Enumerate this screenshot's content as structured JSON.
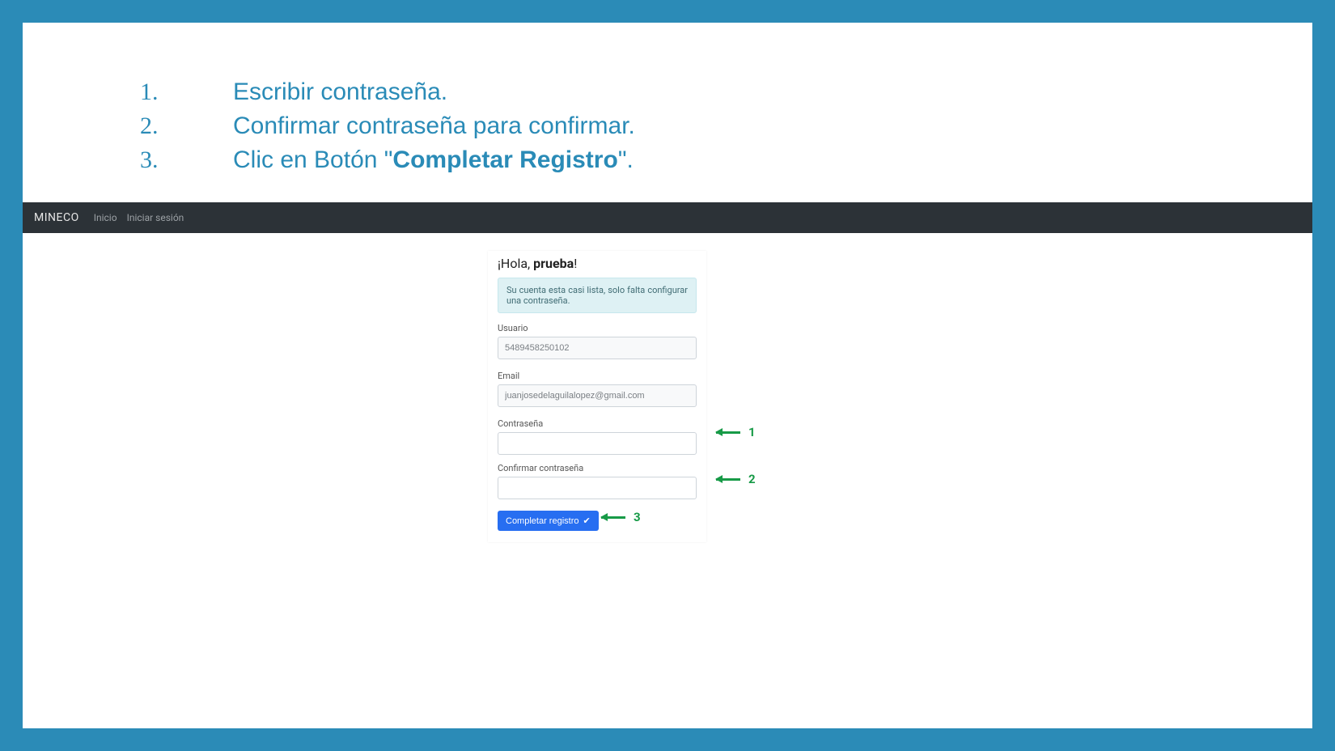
{
  "instructions": {
    "items": [
      {
        "num": "1.",
        "text_pre": "Escribir contraseña.",
        "text_bold": "",
        "text_post": ""
      },
      {
        "num": "2.",
        "text_pre": "Confirmar contraseña para confirmar.",
        "text_bold": "",
        "text_post": ""
      },
      {
        "num": "3.",
        "text_pre": "Clic en Botón \"",
        "text_bold": "Completar Registro",
        "text_post": "\"."
      }
    ]
  },
  "navbar": {
    "brand": "MINECO",
    "link_home": "Inicio",
    "link_login": "Iniciar sesión"
  },
  "form": {
    "greeting_prefix": "¡Hola, ",
    "greeting_name": "prueba",
    "greeting_suffix": "!",
    "alert": "Su cuenta esta casi lista, solo falta configurar una contraseña.",
    "label_user": "Usuario",
    "value_user": "5489458250102",
    "label_email": "Email",
    "value_email": "juanjosedelaguilalopez@gmail.com",
    "label_password": "Contraseña",
    "label_confirm": "Confirmar contraseña",
    "btn_complete": "Completar registro"
  },
  "annotations": {
    "a1": "1",
    "a2": "2",
    "a3": "3"
  }
}
